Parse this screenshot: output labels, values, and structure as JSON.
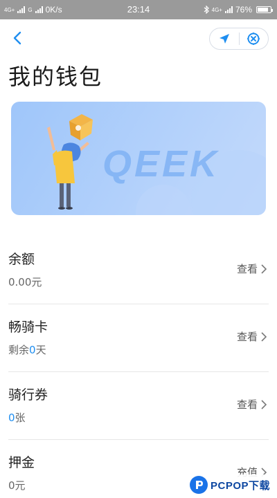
{
  "status_bar": {
    "net1": "4G+",
    "net2": "G",
    "speed": "0K/s",
    "time": "23:14",
    "net3": "4G+",
    "battery": "76%"
  },
  "nav": {
    "back_icon": "chevron-left-icon",
    "location_icon": "navigation-arrow-icon",
    "close_icon": "target-close-icon"
  },
  "page": {
    "title": "我的钱包"
  },
  "banner": {
    "brand_text": "QEEK",
    "illustration": "person-holding-box"
  },
  "wallet": {
    "balance": {
      "title": "余额",
      "value": "0.00元",
      "action": "查看"
    },
    "ride_card": {
      "title": "畅骑卡",
      "prefix": "剩余",
      "days": "0",
      "suffix": "天",
      "action": "查看"
    },
    "coupon": {
      "title": "骑行券",
      "count": "0",
      "unit": "张",
      "action": "查看"
    },
    "deposit": {
      "title": "押金",
      "value": "0元",
      "action": "充值"
    }
  },
  "watermark": {
    "text": "PCPOP下载"
  },
  "colors": {
    "accent": "#1e8ef0",
    "banner": "#a9cbfa",
    "status_bar": "#9a9a9a"
  }
}
